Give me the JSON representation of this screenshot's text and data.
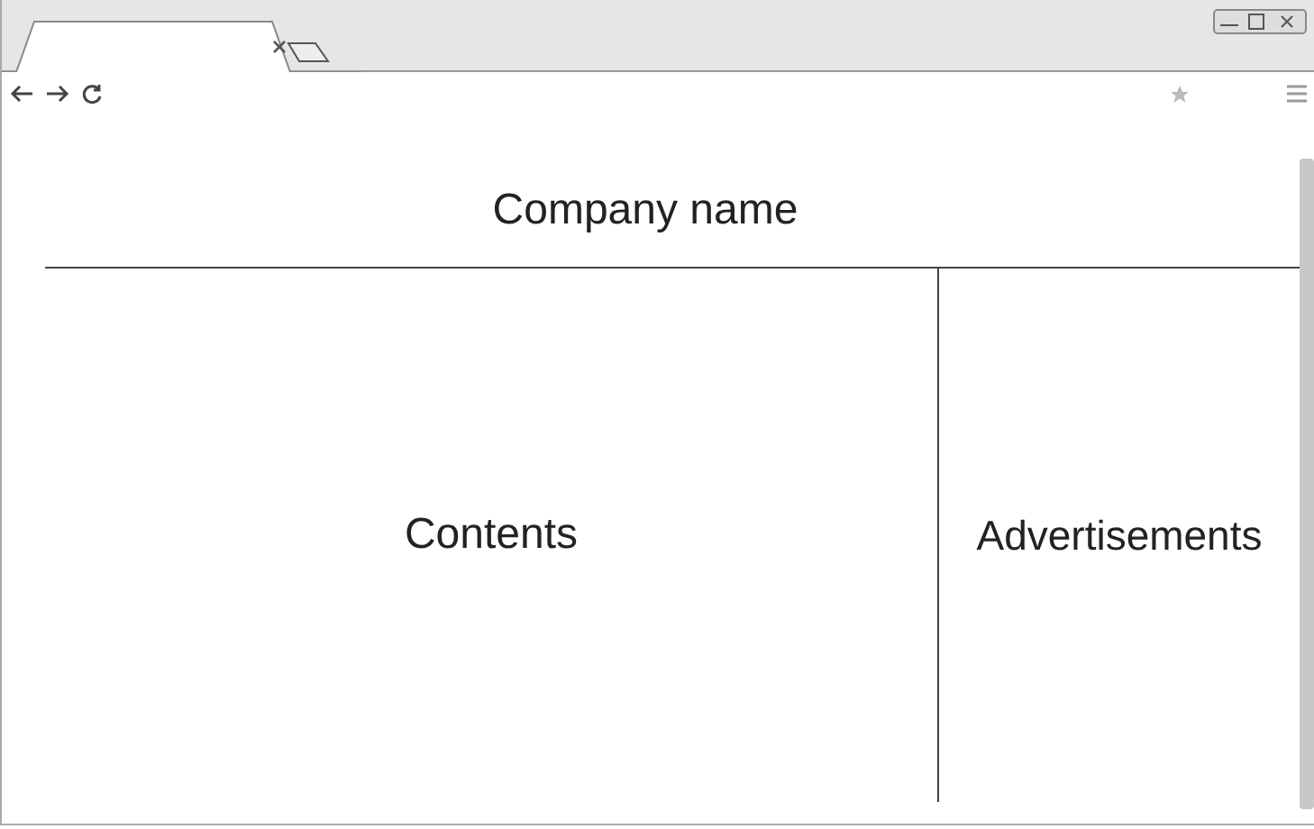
{
  "header": {
    "title": "Company name"
  },
  "content": {
    "label": "Contents"
  },
  "sidebar": {
    "label": "Advertisements"
  }
}
